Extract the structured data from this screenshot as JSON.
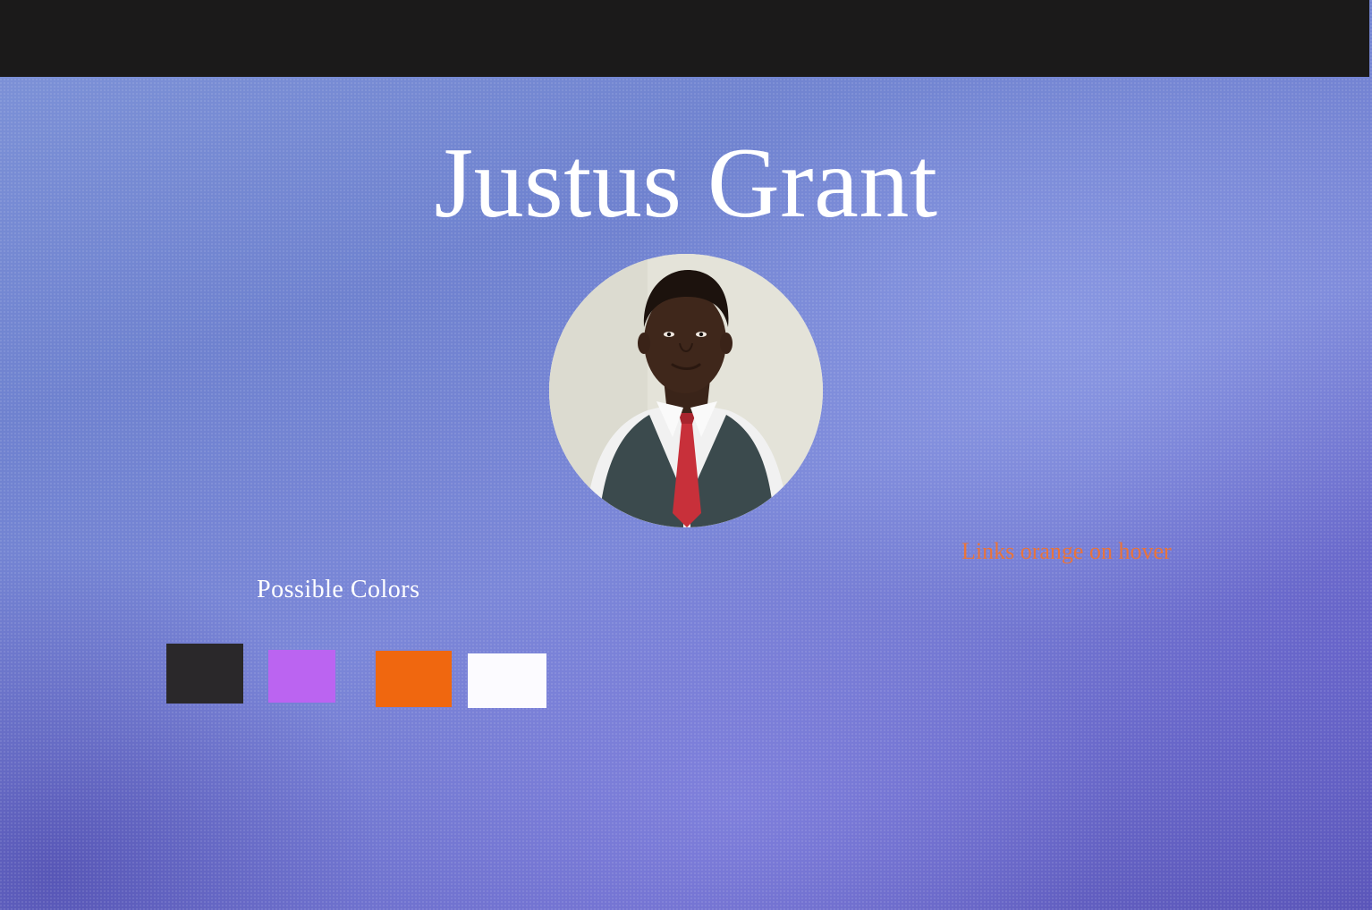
{
  "header": {
    "title": "Justus Grant"
  },
  "profile": {
    "avatar_alt": "Portrait photo"
  },
  "notes": {
    "link_hover": "Links orange on hover"
  },
  "palette": {
    "heading": "Possible Colors",
    "swatches": [
      {
        "name": "black",
        "color": "#2a282a"
      },
      {
        "name": "purple",
        "color": "#bb64f1"
      },
      {
        "name": "orange",
        "color": "#f0670f"
      },
      {
        "name": "white",
        "color": "#fcfbff"
      }
    ]
  },
  "theme": {
    "topbar_color": "#1b1a1a",
    "link_hover_color": "#e9743a"
  }
}
